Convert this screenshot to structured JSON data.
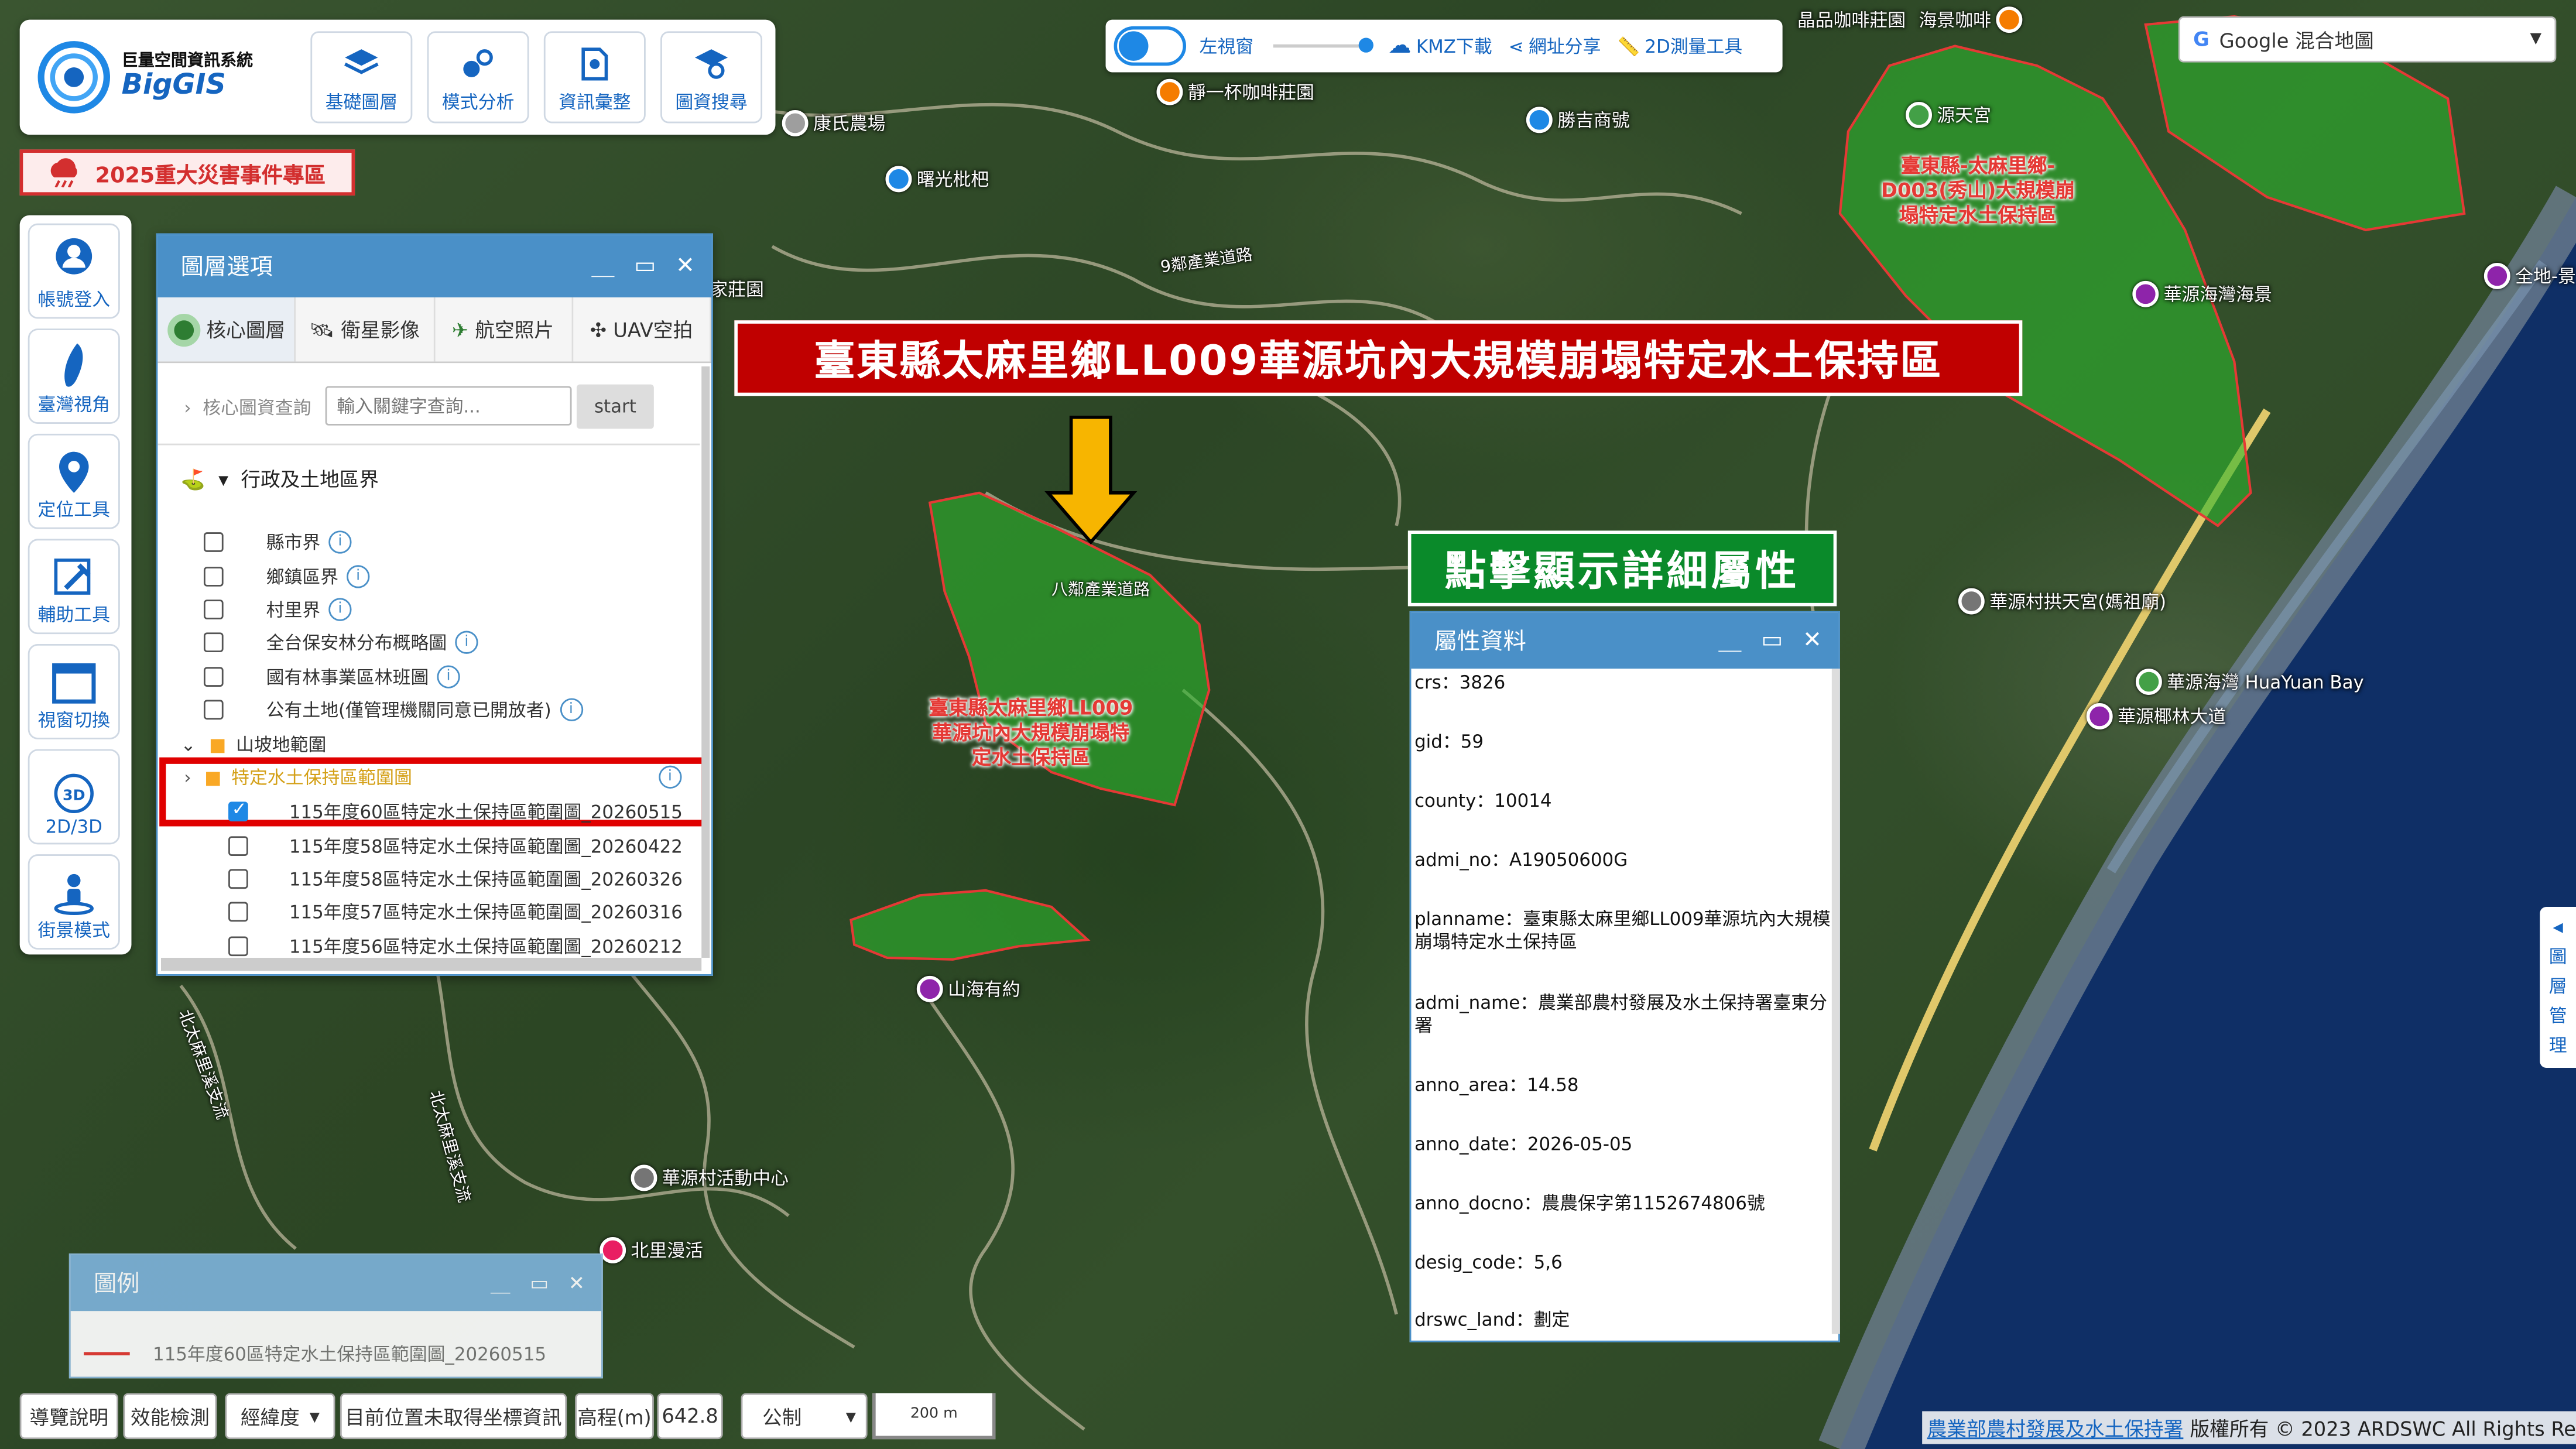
{
  "logo": {
    "subtitle": "巨量空間資訊系統",
    "name": "BigGIS"
  },
  "toolbar": {
    "items": [
      "基礎圖層",
      "模式分析",
      "資訊彙整",
      "圖資搜尋"
    ]
  },
  "disaster_button": "2025重大災害事件專區",
  "left_toolbar": {
    "items": [
      "帳號登入",
      "臺灣視角",
      "定位工具",
      "輔助工具",
      "視窗切換",
      "2D/3D",
      "街景模式"
    ]
  },
  "top_bar": {
    "split_view": "左視窗",
    "kmz": "KMZ下載",
    "share": "網址分享",
    "measure": "2D測量工具"
  },
  "basemap_select": {
    "value": "Google 混合地圖"
  },
  "layer_panel": {
    "title": "圖層選項",
    "tabs": [
      "核心圖層",
      "衛星影像",
      "航空照片",
      "UAV空拍"
    ],
    "query_label": "核心圖資查詢",
    "query_placeholder": "輸入關鍵字查詢...",
    "query_button": "start",
    "group": "行政及土地區界",
    "items": [
      "縣市界",
      "鄉鎮區界",
      "村里界",
      "全台保安林分布概略圖",
      "國有林事業區林班圖",
      "公有土地(僅管理機關同意已開放者)"
    ],
    "folder": "山坡地範圍",
    "subfolder": "特定水土保持區範圍圖",
    "sublayers": [
      "115年度60區特定水土保持區範圍圖_20260515",
      "115年度58區特定水土保持區範圍圖_20260422",
      "115年度58區特定水土保持區範圍圖_20260326",
      "115年度57區特定水土保持區範圍圖_20260316",
      "115年度56區特定水土保持區範圍圖_20260212"
    ]
  },
  "legend": {
    "title": "圖例",
    "entry": "115年度60區特定水土保持區範圍圖_20260515"
  },
  "bottom_bar": {
    "guide": "導覽說明",
    "perf": "效能檢測",
    "coord_type": "經緯度",
    "coord": "目前位置未取得坐標資訊",
    "elev_label": "高程(m)",
    "elev_value": "642.8",
    "unit": "公制",
    "scale": "200 m"
  },
  "banner": "臺東縣太麻里鄉LL009華源坑內大規模崩塌特定水土保持區",
  "click_banner": "點擊顯示詳細屬性",
  "attr_panel": {
    "title": "屬性資料",
    "rows": [
      "crs：3826",
      "gid：59",
      "county：10014",
      "admi_no：A19050600G",
      "planname：臺東縣太麻里鄉LL009華源坑內大規模崩塌特定水土保持區",
      "admi_name：農業部農村發展及水土保持署臺東分署",
      "anno_area：14.58",
      "anno_date：2026-05-05",
      "anno_docno：農農保字第1152674806號",
      "desig_code：5,6",
      "drswc_land：劃定"
    ]
  },
  "map_labels": {
    "zone1": "臺東縣太麻里鄉LL009華源坑內大規模崩塌特定水土保持區",
    "zone2": "臺東縣-太麻里鄉-D003(秀山)大規模崩塌特定水土保持區",
    "roads": [
      "9鄰產業道路",
      "八鄰產業道路",
      "北太麻里溪支流",
      "北太麻里溪支流"
    ],
    "pois": [
      "康氏農場",
      "曙光枇杷",
      "靜一杯咖啡莊園",
      "勝吉商號",
      "晶品咖啡莊園",
      "海景咖啡",
      "源天宮",
      "華源海灣海景",
      "山海有約",
      "華源村活動中心",
      "北里漫活",
      "華源村拱天宮(媽祖廟)",
      "華源海灣 HuaYuan Bay",
      "華源椰林大道",
      "全地-景",
      "家莊園"
    ]
  },
  "side_tab": [
    "圖",
    "層",
    "管",
    "理"
  ],
  "credit": {
    "link": "農業部農村發展及水土保持署",
    "text": "版權所有 © 2023 ARDSWC All Rights Reserved."
  },
  "colors": {
    "accent": "#4a90c8",
    "banner": "#c00000",
    "click_banner": "#0a8a2a",
    "zone": "#e53935"
  }
}
